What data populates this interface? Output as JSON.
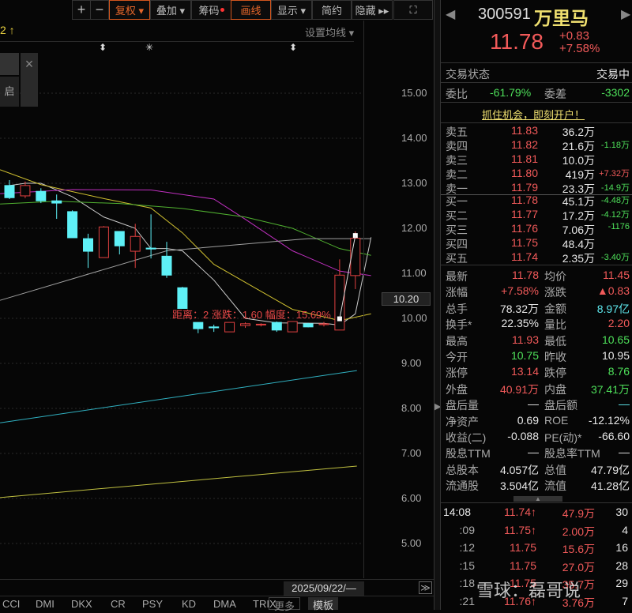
{
  "toolbar": {
    "plus": "+",
    "minus": "−",
    "fuquan": "复权 ▾",
    "diejia": "叠加 ▾",
    "chouma": "筹码",
    "huaxian": "画线",
    "xianshi": "显示 ▾",
    "jianyue": "简约",
    "yincang": "隐藏 ▸▸",
    "fullscreen": "⛶"
  },
  "chart_header": {
    "left_text": "2 ↑",
    "ma_settings": "设置均线 ▾"
  },
  "markers": [
    "⬍",
    "✳",
    "⬍"
  ],
  "overlay": {
    "close": "×",
    "button": "启"
  },
  "axis": {
    "labels": [
      "15.00",
      "14.00",
      "13.00",
      "12.00",
      "11.00",
      "10.00",
      "9.00",
      "8.00",
      "7.00",
      "6.00",
      "5.00"
    ],
    "values": [
      15,
      14,
      13,
      12,
      11,
      10,
      9,
      8,
      7,
      6,
      5
    ],
    "cursor_price": "10.20"
  },
  "measure_text": "距离：2 涨跌：1.60 幅度：15.69%",
  "date_label": "2025/09/22/—",
  "scroll_right": "≫",
  "bottom_tabs": [
    "CCI",
    "DMI",
    "DKX",
    "CR",
    "PSY",
    "KD",
    "DMA",
    "TRIX"
  ],
  "more": "更多",
  "template": "模板",
  "colors": {
    "up": "#e04040",
    "down": "#5ef0f6",
    "ma5": "#cccccc",
    "ma10": "#d0c030",
    "ma20": "#c030c0",
    "ma30": "#50b030",
    "ma60": "#a0a0a0",
    "ma120": "#30b0c0",
    "ma250": "#c0c040"
  },
  "candles": [
    [
      12.95,
      13.07,
      12.65,
      12.68
    ],
    [
      12.72,
      13.04,
      12.67,
      12.95
    ],
    [
      12.82,
      12.89,
      12.56,
      12.61
    ],
    [
      12.61,
      12.75,
      12.21,
      12.56
    ],
    [
      12.37,
      12.4,
      11.79,
      11.79
    ],
    [
      11.77,
      11.88,
      11.12,
      11.49
    ],
    [
      11.35,
      12.05,
      11.35,
      12.03
    ],
    [
      11.93,
      11.93,
      11.42,
      11.61
    ],
    [
      11.49,
      12.1,
      11.12,
      11.82
    ],
    [
      11.56,
      12.31,
      11.33,
      11.54
    ],
    [
      11.38,
      11.7,
      10.9,
      10.96
    ],
    [
      10.68,
      10.7,
      10.22,
      10.22
    ],
    [
      9.91,
      9.91,
      9.67,
      9.77
    ],
    [
      9.81,
      9.86,
      9.7,
      9.79
    ],
    [
      9.7,
      9.91,
      9.7,
      9.91
    ],
    [
      9.84,
      9.91,
      9.79,
      9.88
    ],
    [
      9.86,
      9.89,
      9.82,
      9.87
    ],
    [
      9.91,
      9.93,
      9.7,
      9.74
    ],
    [
      9.7,
      9.93,
      9.7,
      9.93
    ],
    [
      9.88,
      9.9,
      9.8,
      9.81
    ],
    [
      9.86,
      9.92,
      9.82,
      9.88
    ],
    [
      9.74,
      11.31,
      9.74,
      10.96
    ],
    [
      10.95,
      11.93,
      10.65,
      11.78
    ]
  ],
  "ma": {
    "ma5": [
      [
        0,
        12.95
      ],
      [
        1,
        13.0
      ],
      [
        2,
        13.0
      ],
      [
        4,
        12.7
      ],
      [
        6,
        12.25
      ],
      [
        8,
        12.0
      ],
      [
        9,
        11.55
      ],
      [
        10,
        11.55
      ],
      [
        11,
        11.5
      ],
      [
        13,
        10.85
      ],
      [
        15,
        10.0
      ],
      [
        17,
        9.9
      ],
      [
        20,
        9.89
      ],
      [
        21,
        9.85
      ],
      [
        22,
        10.1
      ],
      [
        23,
        11.8
      ]
    ],
    "ma10": [
      [
        -0.6,
        13.3
      ],
      [
        2,
        12.97
      ],
      [
        6,
        12.66
      ],
      [
        9,
        12.45
      ],
      [
        11,
        11.9
      ],
      [
        13,
        11.2
      ],
      [
        16,
        10.6
      ],
      [
        18,
        10.2
      ],
      [
        21,
        9.95
      ],
      [
        23,
        10.1
      ]
    ],
    "ma20": [
      [
        -0.6,
        12.77
      ],
      [
        4,
        12.86
      ],
      [
        9,
        12.85
      ],
      [
        13,
        12.65
      ],
      [
        15,
        12.2
      ],
      [
        18,
        11.5
      ],
      [
        21,
        11.05
      ],
      [
        23,
        10.95
      ]
    ],
    "ma30": [
      [
        -0.6,
        12.54
      ],
      [
        3,
        12.6
      ],
      [
        7,
        12.55
      ],
      [
        11,
        12.44
      ],
      [
        15,
        12.25
      ],
      [
        18,
        12.0
      ],
      [
        21,
        11.55
      ],
      [
        23,
        11.4
      ]
    ],
    "ma60": [
      [
        -0.6,
        10.4
      ],
      [
        10,
        11.5
      ],
      [
        19,
        11.77
      ],
      [
        23,
        11.77
      ]
    ],
    "ma120": [
      [
        -0.6,
        7.68
      ],
      [
        22.1,
        8.84
      ]
    ],
    "ma250": [
      [
        -0.6,
        6.02
      ],
      [
        22.1,
        6.72
      ]
    ]
  },
  "quote": {
    "code": "300591",
    "name": "万里马",
    "price": "11.78",
    "change": "+0.83",
    "pct": "+7.58%",
    "status_label": "交易状态",
    "status": "交易中",
    "weibi_label": "委比",
    "weibi": "-61.79%",
    "weicha_label": "委差",
    "weicha": "-3302",
    "banner": "抓住机会，即刻开户！"
  },
  "sells": [
    {
      "label": "卖五",
      "price": "11.83",
      "vol": "36.2万",
      "chg": ""
    },
    {
      "label": "卖四",
      "price": "11.82",
      "vol": "21.6万",
      "chg": "-1.18万"
    },
    {
      "label": "卖三",
      "price": "11.81",
      "vol": "10.0万",
      "chg": ""
    },
    {
      "label": "卖二",
      "price": "11.80",
      "vol": "419万",
      "chg": "+7.32万"
    },
    {
      "label": "卖一",
      "price": "11.79",
      "vol": "23.3万",
      "chg": "-14.9万"
    }
  ],
  "buys": [
    {
      "label": "买一",
      "price": "11.78",
      "vol": "45.1万",
      "chg": "-4.48万"
    },
    {
      "label": "买二",
      "price": "11.77",
      "vol": "17.2万",
      "chg": "-4.12万"
    },
    {
      "label": "买三",
      "price": "11.76",
      "vol": "7.06万",
      "chg": "-1176"
    },
    {
      "label": "买四",
      "price": "11.75",
      "vol": "48.4万",
      "chg": ""
    },
    {
      "label": "买五",
      "price": "11.74",
      "vol": "2.35万",
      "chg": "-3.40万"
    }
  ],
  "stats": [
    {
      "l1": "最新",
      "v1": "11.78",
      "c1": "red",
      "l2": "均价",
      "v2": "11.45",
      "c2": "red"
    },
    {
      "l1": "涨幅",
      "v1": "+7.58%",
      "c1": "red",
      "l2": "涨跌",
      "v2": "▲0.83",
      "c2": "red"
    },
    {
      "l1": "总手",
      "v1": "78.32万",
      "c1": "wht",
      "l2": "金额",
      "v2": "8.97亿",
      "c2": "cyn"
    },
    {
      "l1": "换手*",
      "v1": "22.35%",
      "c1": "wht",
      "l2": "量比",
      "v2": "2.20",
      "c2": "red"
    },
    {
      "l1": "最高",
      "v1": "11.93",
      "c1": "red",
      "l2": "最低",
      "v2": "10.65",
      "c2": "grn"
    },
    {
      "l1": "今开",
      "v1": "10.75",
      "c1": "grn",
      "l2": "昨收",
      "v2": "10.95",
      "c2": "wht"
    },
    {
      "l1": "涨停",
      "v1": "13.14",
      "c1": "red",
      "l2": "跌停",
      "v2": "8.76",
      "c2": "grn"
    },
    {
      "l1": "外盘",
      "v1": "40.91万",
      "c1": "red",
      "l2": "内盘",
      "v2": "37.41万",
      "c2": "grn"
    },
    {
      "l1": "盘后量",
      "v1": "—",
      "c1": "wht",
      "l2": "盘后额",
      "v2": "—",
      "c2": "cyn"
    },
    {
      "l1": "净资产",
      "v1": "0.69",
      "c1": "wht",
      "l2": "ROE",
      "v2": "-12.12%",
      "c2": "wht"
    },
    {
      "l1": "收益(二)",
      "v1": "-0.088",
      "c1": "wht",
      "l2": "PE(动)*",
      "v2": "-66.60",
      "c2": "wht"
    },
    {
      "l1": "股息TTM",
      "v1": "—",
      "c1": "wht",
      "l2": "股息率TTM",
      "v2": "—",
      "c2": "wht"
    },
    {
      "l1": "总股本",
      "v1": "4.057亿",
      "c1": "wht",
      "l2": "总值",
      "v2": "47.79亿",
      "c2": "wht"
    },
    {
      "l1": "流通股",
      "v1": "3.504亿",
      "c1": "wht",
      "l2": "流值",
      "v2": "41.28亿",
      "c2": "wht"
    }
  ],
  "trades": [
    {
      "time": "14:08",
      "price": "11.74↑",
      "vol": "47.9万",
      "n": "30"
    },
    {
      "time": ":09",
      "price": "11.75↑",
      "vol": "2.00万",
      "n": "4"
    },
    {
      "time": ":12",
      "price": "11.75",
      "vol": "15.6万",
      "n": "16"
    },
    {
      "time": ":15",
      "price": "11.75",
      "vol": "27.0万",
      "n": "28"
    },
    {
      "time": ":18",
      "price": "11.75",
      "vol": "35.7万",
      "n": "29"
    },
    {
      "time": ":21",
      "price": "11.76↑",
      "vol": "3.76万",
      "n": "7"
    }
  ],
  "watermark": "雪球：磊哥说"
}
